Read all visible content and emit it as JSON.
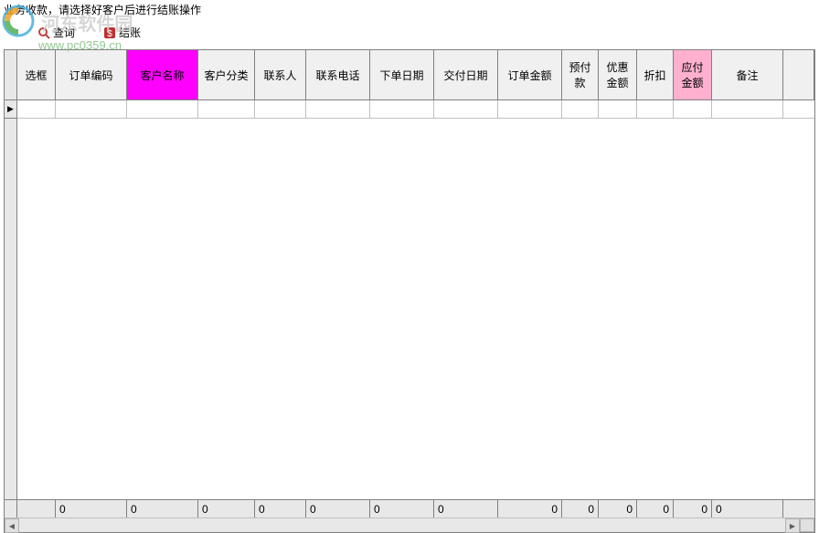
{
  "watermark": {
    "text": "河东软件园",
    "url": "www.pc0359.cn"
  },
  "title": "业务收款，请选择好客户后进行结账操作",
  "toolbar": {
    "query_label": "查询",
    "checkout_label": "结账"
  },
  "columns": {
    "select": "选框",
    "order_no": "订单编码",
    "customer": "客户名称",
    "category": "客户分类",
    "contact": "联系人",
    "phone": "联系电话",
    "order_date": "下单日期",
    "deliver_date": "交付日期",
    "amount": "订单金额",
    "prepay": "预付款",
    "discount": "优惠金额",
    "rebate": "折扣",
    "payable": "应付金额",
    "remark": "备注"
  },
  "row_marker": "▶",
  "footer": {
    "select": "",
    "order_no": "0",
    "customer": "0",
    "category": "0",
    "contact": "0",
    "phone": "0",
    "order_date": "0",
    "deliver_date": "0",
    "amount": "0",
    "prepay": "0",
    "discount": "0",
    "rebate": "0",
    "payable": "0",
    "remark": "0"
  }
}
